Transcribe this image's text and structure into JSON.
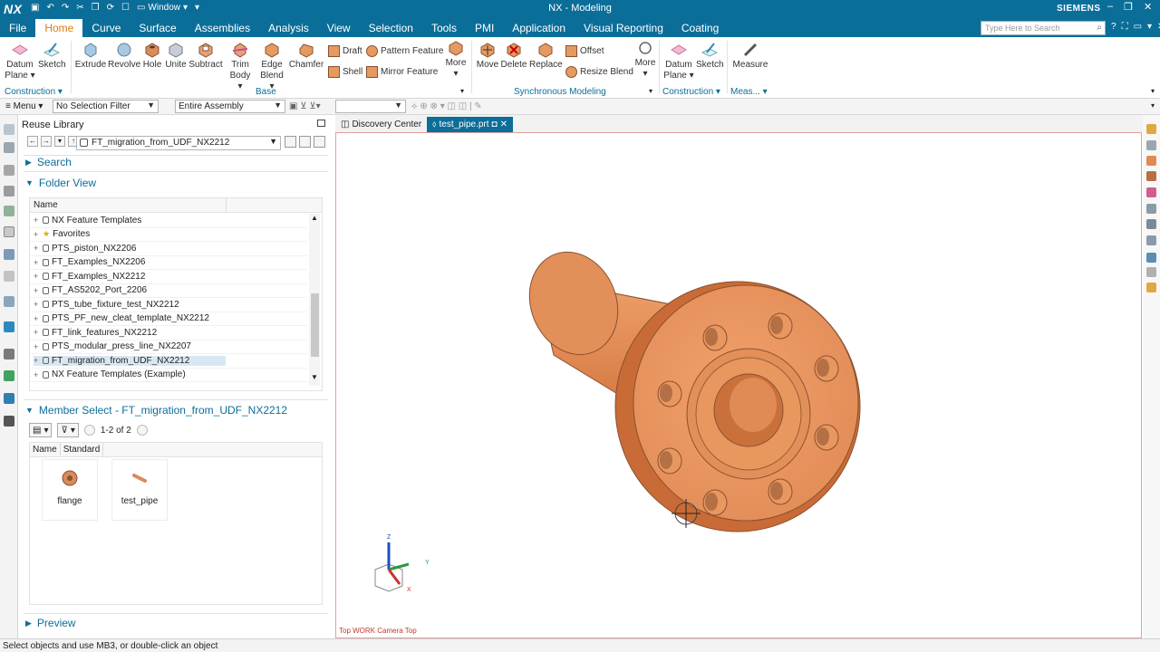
{
  "titlebar": {
    "logo": "NX",
    "window_menu": "Window",
    "title": "NX - Modeling",
    "brand": "SIEMENS"
  },
  "menubar": {
    "tabs": [
      "File",
      "Home",
      "Curve",
      "Surface",
      "Assemblies",
      "Analysis",
      "View",
      "Selection",
      "Tools",
      "PMI",
      "Application",
      "Visual Reporting",
      "Coating"
    ],
    "active_tab": "Home",
    "search_placeholder": "Type Here to Search"
  },
  "ribbon": {
    "datum_plane": "Datum Plane",
    "sketch": "Sketch",
    "extrude": "Extrude",
    "revolve": "Revolve",
    "hole": "Hole",
    "unite": "Unite",
    "subtract": "Subtract",
    "trim_body": "Trim Body",
    "edge_blend": "Edge Blend",
    "chamfer": "Chamfer",
    "draft": "Draft",
    "pattern_feature": "Pattern Feature",
    "shell": "Shell",
    "mirror_feature": "Mirror Feature",
    "more": "More",
    "move": "Move",
    "delete": "Delete",
    "replace": "Replace",
    "offset": "Offset",
    "resize_blend": "Resize Blend",
    "more2": "More",
    "datum_plane2": "Datum Plane",
    "sketch2": "Sketch",
    "measure": "Measure",
    "groups": {
      "construction": "Construction",
      "base": "Base",
      "synchronous": "Synchronous Modeling",
      "construction2": "Construction",
      "measure": "Meas..."
    }
  },
  "toolbar": {
    "menu": "Menu",
    "selection_filter": "No Selection Filter",
    "assembly_scope": "Entire Assembly",
    "empty_select": ""
  },
  "reuse_library": {
    "title": "Reuse Library",
    "library": "FT_migration_from_UDF_NX2212",
    "search_label": "Search",
    "folder_view_label": "Folder View",
    "name_column": "Name",
    "folders": [
      {
        "name": "NX Feature Templates",
        "icon": "folder-icon"
      },
      {
        "name": "Favorites",
        "icon": "star-icon"
      },
      {
        "name": "PTS_piston_NX2206",
        "icon": "folder-icon"
      },
      {
        "name": "FT_Examples_NX2206",
        "icon": "folder-icon"
      },
      {
        "name": "FT_Examples_NX2212",
        "icon": "folder-icon"
      },
      {
        "name": "FT_AS5202_Port_2206",
        "icon": "folder-icon"
      },
      {
        "name": "PTS_tube_fixture_test_NX2212",
        "icon": "folder-icon"
      },
      {
        "name": "PTS_PF_new_cleat_template_NX2212",
        "icon": "folder-icon"
      },
      {
        "name": "FT_link_features_NX2212",
        "icon": "folder-icon"
      },
      {
        "name": "PTS_modular_press_line_NX2207",
        "icon": "folder-icon"
      },
      {
        "name": "FT_migration_from_UDF_NX2212",
        "icon": "folder-icon",
        "selected": true
      },
      {
        "name": "NX Feature Templates (Example)",
        "icon": "folder-icon"
      }
    ],
    "member_select_label": "Member Select - FT_migration_from_UDF_NX2212",
    "member_count": "1-2 of 2",
    "member_columns": [
      "Name",
      "Standard"
    ],
    "members": [
      {
        "name": "flange"
      },
      {
        "name": "test_pipe"
      }
    ],
    "preview_label": "Preview"
  },
  "graphics": {
    "tabs": [
      {
        "label": "Discovery Center",
        "active": false
      },
      {
        "label": "test_pipe.prt",
        "active": true
      }
    ],
    "view_label": "Top WORK Camera Top",
    "part_color": "#e08a55"
  },
  "status": "Select objects and use MB3, or double-click an object"
}
